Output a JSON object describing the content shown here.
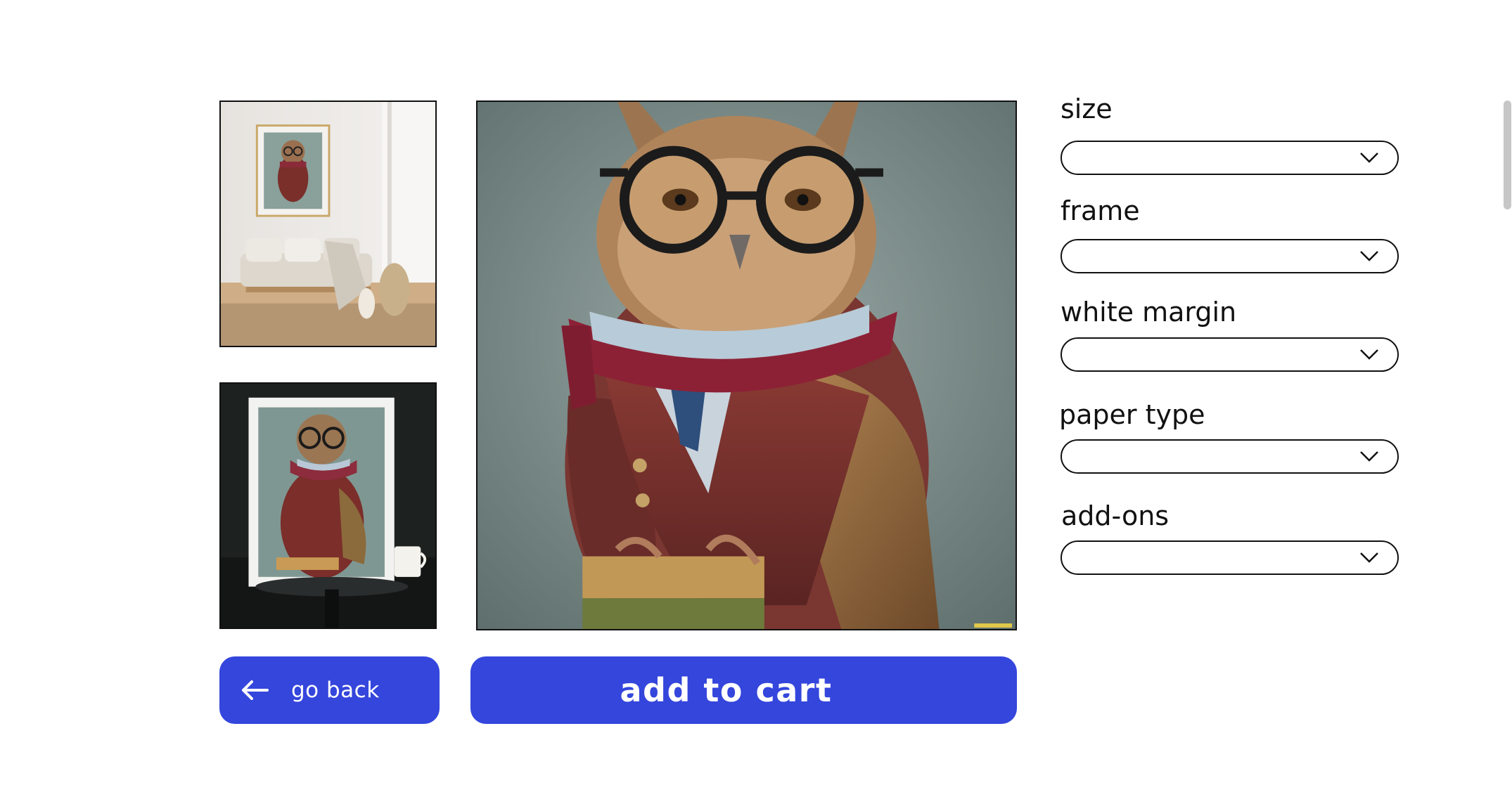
{
  "options": [
    {
      "label": "size",
      "value": ""
    },
    {
      "label": "frame",
      "value": ""
    },
    {
      "label": "white margin",
      "value": ""
    },
    {
      "label": "paper type",
      "value": ""
    },
    {
      "label": "add-ons",
      "value": ""
    }
  ],
  "buttons": {
    "go_back": "go back",
    "add_to_cart": "add to cart"
  },
  "icons": {
    "go_back": "arrow-left-icon",
    "select": "chevron-down-icon"
  },
  "colors": {
    "accent": "#3446dc",
    "button_text": "#ffffff",
    "border": "#111111"
  }
}
